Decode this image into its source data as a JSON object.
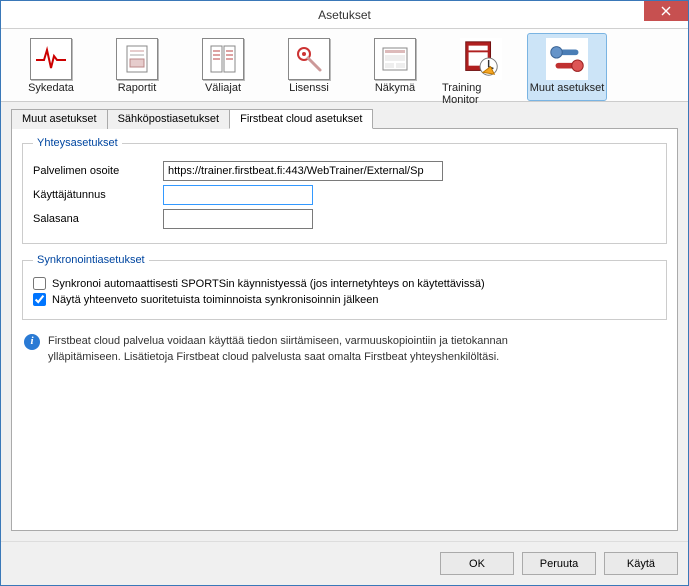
{
  "window": {
    "title": "Asetukset"
  },
  "toolbar": {
    "items": [
      {
        "label": "Sykedata"
      },
      {
        "label": "Raportit"
      },
      {
        "label": "Väliajat"
      },
      {
        "label": "Lisenssi"
      },
      {
        "label": "Näkymä"
      },
      {
        "label": "Training Monitor"
      },
      {
        "label": "Muut asetukset"
      }
    ]
  },
  "tabs": {
    "items": [
      {
        "label": "Muut asetukset"
      },
      {
        "label": "Sähköpostiasetukset"
      },
      {
        "label": "Firstbeat cloud asetukset"
      }
    ],
    "active_index": 2
  },
  "connection": {
    "legend": "Yhteysasetukset",
    "server_label": "Palvelimen osoite",
    "server_value": "https://trainer.firstbeat.fi:443/WebTrainer/External/Sp",
    "username_label": "Käyttäjätunnus",
    "username_value": "",
    "password_label": "Salasana",
    "password_value": ""
  },
  "sync": {
    "legend": "Synkronointiasetukset",
    "auto_label": "Synkronoi automaattisesti SPORTSin käynnistyessä (jos internetyhteys on käytettävissä)",
    "auto_checked": false,
    "summary_label": "Näytä yhteenveto suoritetuista toiminnoista synkronisoinnin jälkeen",
    "summary_checked": true
  },
  "info": {
    "text": "Firstbeat cloud palvelua voidaan käyttää tiedon siirtämiseen, varmuuskopiointiin ja tietokannan ylläpitämiseen. Lisätietoja Firstbeat cloud palvelusta saat omalta Firstbeat yhteyshenkilöltäsi."
  },
  "buttons": {
    "ok": "OK",
    "cancel": "Peruuta",
    "apply": "Käytä"
  }
}
